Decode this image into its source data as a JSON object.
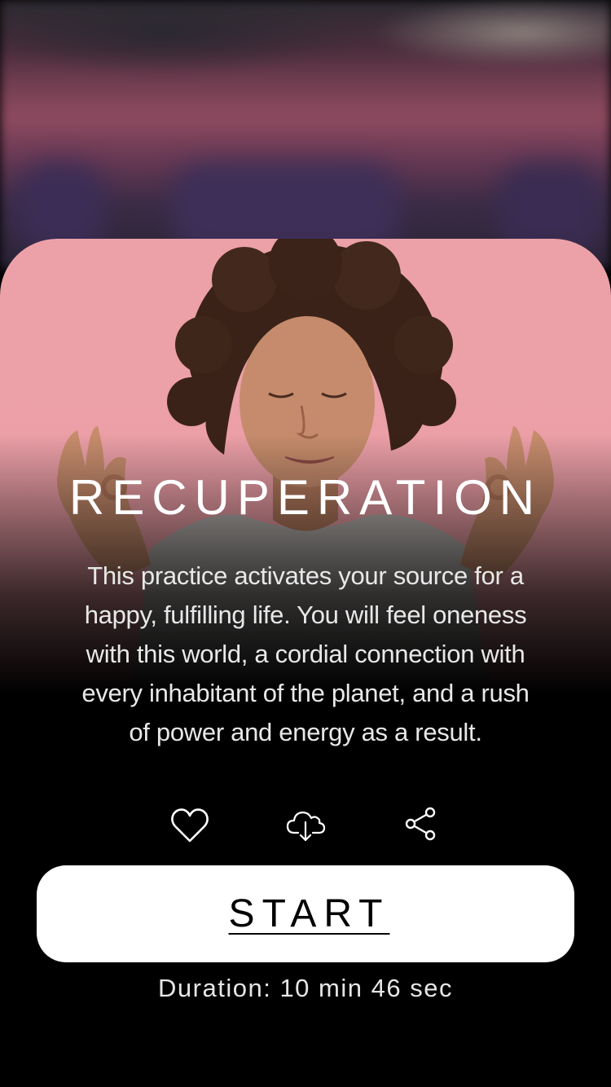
{
  "practice": {
    "title": "RECUPERATION",
    "description": "This practice activates your source for a happy, fulfilling life. You will feel oneness with this world, a cordial connection with every inhabitant of the planet, and a rush of power and energy as a result.",
    "duration_text": "Duration: 10 min 46 sec"
  },
  "actions": {
    "favorite_icon": "heart-icon",
    "download_icon": "cloud-download-icon",
    "share_icon": "share-icon"
  },
  "start_button": {
    "label": "START"
  },
  "colors": {
    "card_background": "#eca1a9",
    "page_background": "#000000",
    "button_background": "#ffffff"
  }
}
